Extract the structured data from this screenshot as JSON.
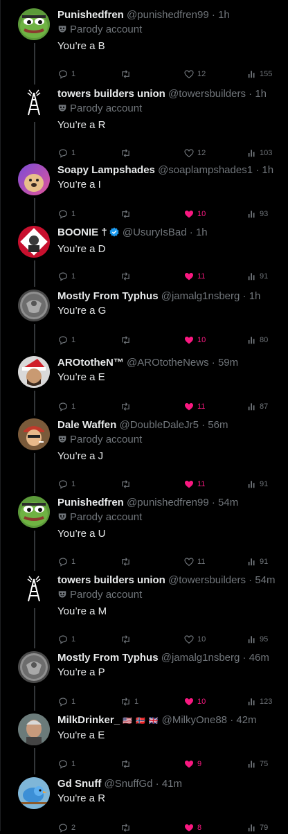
{
  "parody_label": "Parody account",
  "tweets": [
    {
      "name": "Punishedfren",
      "handle": "@punishedfren99",
      "time": "1h",
      "parody": true,
      "text": "You’re a B",
      "replies": "1",
      "retweets": "",
      "likes": "12",
      "liked": false,
      "views": "155",
      "avatar": "pepe"
    },
    {
      "name": "towers builders union",
      "handle": "@towersbuilders",
      "time": "1h",
      "parody": true,
      "text": "You’re a R",
      "replies": "1",
      "retweets": "",
      "likes": "12",
      "liked": false,
      "views": "103",
      "avatar": "tower"
    },
    {
      "name": "Soapy Lampshades",
      "handle": "@soaplampshades1",
      "time": "1h",
      "parody": false,
      "text": "You’re a I",
      "replies": "1",
      "retweets": "",
      "likes": "10",
      "liked": true,
      "views": "93",
      "avatar": "dog"
    },
    {
      "name": "BOONIE †",
      "handle": "@UsuryIsBad",
      "time": "1h",
      "parody": false,
      "verified": true,
      "text": "You’re a D",
      "replies": "1",
      "retweets": "",
      "likes": "11",
      "liked": true,
      "views": "91",
      "avatar": "boonie"
    },
    {
      "name": "Mostly From Typhus",
      "handle": "@jamalg1nsberg",
      "time": "1h",
      "parody": false,
      "text": "You’re a G",
      "replies": "1",
      "retweets": "",
      "likes": "10",
      "liked": true,
      "views": "80",
      "avatar": "coin"
    },
    {
      "name": "ARОtotheN™",
      "handle": "@AROtotheNews",
      "time": "59m",
      "parody": false,
      "text": "You’re a E",
      "replies": "1",
      "retweets": "",
      "likes": "11",
      "liked": true,
      "views": "87",
      "avatar": "santa"
    },
    {
      "name": "Dale Waffen",
      "handle": "@DoubleDaleJr5",
      "time": "56m",
      "parody": true,
      "text": "You’re a J",
      "replies": "1",
      "retweets": "",
      "likes": "11",
      "liked": true,
      "views": "91",
      "avatar": "dale"
    },
    {
      "name": "Punishedfren",
      "handle": "@punishedfren99",
      "time": "54m",
      "parody": true,
      "text": "You’re a U",
      "replies": "1",
      "retweets": "",
      "likes": "11",
      "liked": false,
      "views": "91",
      "avatar": "pepe"
    },
    {
      "name": "towers builders union",
      "handle": "@towersbuilders",
      "time": "54m",
      "parody": true,
      "text": "You’re a M",
      "replies": "1",
      "retweets": "",
      "likes": "10",
      "liked": false,
      "views": "95",
      "avatar": "tower"
    },
    {
      "name": "Mostly From Typhus",
      "handle": "@jamalg1nsberg",
      "time": "46m",
      "parody": false,
      "text": "You’re a P",
      "replies": "1",
      "retweets": "1",
      "likes": "10",
      "liked": true,
      "views": "123",
      "avatar": "coin"
    },
    {
      "name": "MilkDrinker_",
      "flags": "🇺🇸 🇳🇴 🇬🇧",
      "handle": "@MilkyOne88",
      "time": "42m",
      "parody": false,
      "text": "You're a E",
      "replies": "1",
      "retweets": "",
      "likes": "9",
      "liked": true,
      "views": "75",
      "avatar": "milk"
    },
    {
      "name": "Gd Snuff",
      "handle": "@SnuffGd",
      "time": "41m",
      "parody": false,
      "text": "You're a R",
      "replies": "2",
      "retweets": "",
      "likes": "8",
      "liked": true,
      "views": "79",
      "avatar": "bird"
    }
  ],
  "colors": {
    "background": "#000000",
    "text": "#e7e9ea",
    "muted": "#71767b",
    "like": "#f91880",
    "verified": "#1d9bf0"
  }
}
